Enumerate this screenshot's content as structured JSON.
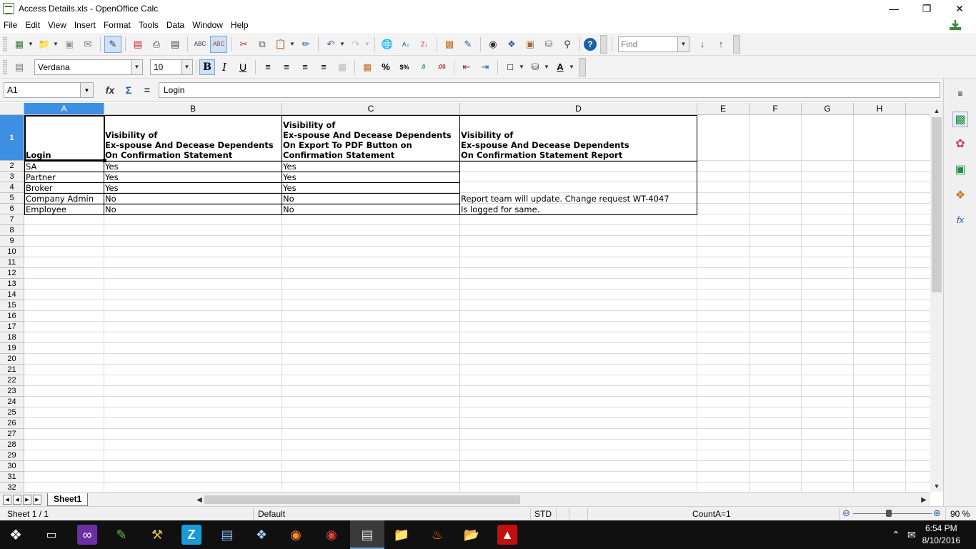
{
  "window": {
    "title": "Access Details.xls - OpenOffice Calc"
  },
  "menu": [
    "File",
    "Edit",
    "View",
    "Insert",
    "Format",
    "Tools",
    "Data",
    "Window",
    "Help"
  ],
  "toolbar": {
    "find_placeholder": "Find",
    "font_name": "Verdana",
    "font_size": "10",
    "bold_label": "B",
    "italic_label": "I",
    "underline_label": "U",
    "percent_label": "%"
  },
  "formula_bar": {
    "cell_ref": "A1",
    "content": "Login",
    "equals_label": "="
  },
  "sheet": {
    "columns": [
      "A",
      "B",
      "C",
      "D",
      "E",
      "F",
      "G",
      "H"
    ],
    "row_numbers": [
      "1",
      "2",
      "3",
      "4",
      "5",
      "6",
      "7",
      "8",
      "9",
      "10",
      "11",
      "12",
      "13",
      "14",
      "15",
      "16",
      "17",
      "18",
      "19",
      "20",
      "21",
      "22",
      "23",
      "24",
      "25",
      "26",
      "27",
      "28",
      "29",
      "30",
      "31",
      "32"
    ],
    "header": {
      "a": "Login",
      "b": [
        "Visibility of",
        "Ex-spouse And Decease Dependents",
        "On Confirmation Statement"
      ],
      "c": [
        "Visibility of",
        "Ex-spouse And Decease Dependents",
        "On Export To PDF Button on",
        "Confirmation Statement"
      ],
      "d": [
        "Visibility of",
        "Ex-spouse And Decease Dependents",
        "On Confirmation Statement Report"
      ]
    },
    "rows": [
      {
        "login": "SA",
        "b": "Yes",
        "c": "Yes"
      },
      {
        "login": "Partner",
        "b": "Yes",
        "c": "Yes"
      },
      {
        "login": "Broker",
        "b": "Yes",
        "c": "Yes"
      },
      {
        "login": "Company Admin",
        "b": "No",
        "c": "No"
      },
      {
        "login": "Employee",
        "b": "No",
        "c": "No"
      }
    ],
    "d_note": [
      "Report team will update. Change request WT-4047",
      "Is logged for same."
    ],
    "tab_name": "Sheet1"
  },
  "status": {
    "sheet": "Sheet 1 / 1",
    "style": "Default",
    "mode": "STD",
    "summary": "CountA=1",
    "zoom": "90 %",
    "zoom_fraction": 0.45
  },
  "taskbar": {
    "time": "6:54 PM",
    "date": "8/10/2016"
  }
}
